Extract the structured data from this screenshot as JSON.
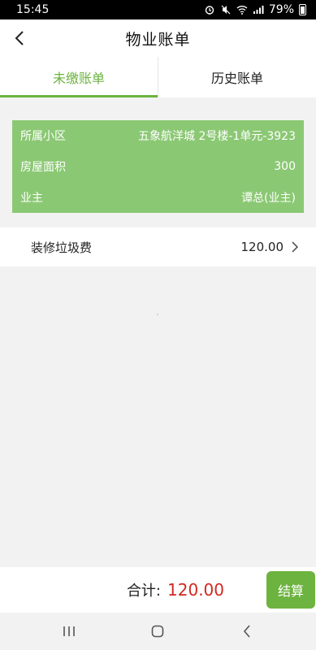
{
  "status_bar": {
    "time": "15:45",
    "battery_percent": "79%",
    "icons": [
      "alarm-icon",
      "mute-icon",
      "wifi-icon",
      "signal-icon",
      "battery-icon"
    ]
  },
  "header": {
    "title": "物业账单",
    "back_icon": "chevron-left-icon"
  },
  "tabs": [
    {
      "label": "未缴账单",
      "active": true
    },
    {
      "label": "历史账单",
      "active": false
    }
  ],
  "info": {
    "community_label": "所属小区",
    "community_value": "五象航洋城 2号楼-1单元-3923",
    "area_label": "房屋面积",
    "area_value": "300",
    "owner_label": "业主",
    "owner_value": "谭总(业主)"
  },
  "fees": [
    {
      "name": "装修垃圾费",
      "amount": "120.00"
    }
  ],
  "footer": {
    "total_label": "合计:",
    "total_value": "120.00",
    "checkout_label": "结算"
  },
  "colors": {
    "accent": "#6cb33f",
    "card_bg": "#8bc874",
    "total": "#d2271f"
  }
}
